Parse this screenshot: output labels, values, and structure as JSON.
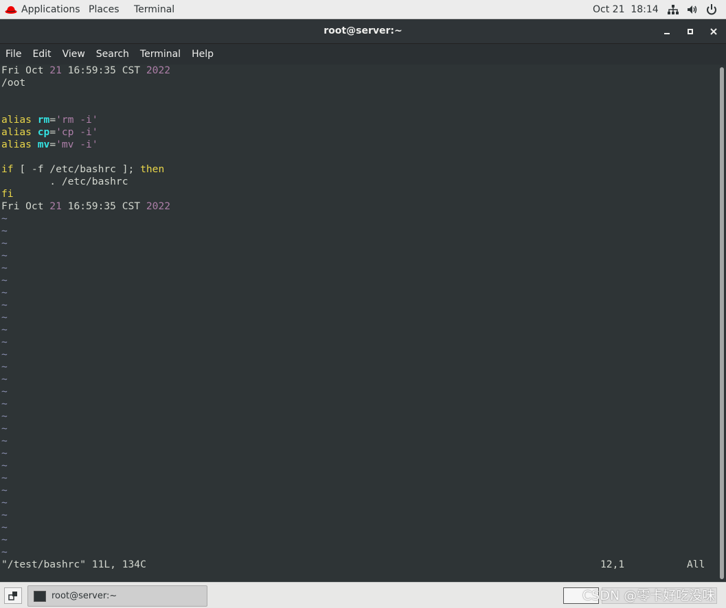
{
  "topbar": {
    "applications": "Applications",
    "places": "Places",
    "terminal": "Terminal",
    "datetime": "Oct 21  18:14",
    "icons": [
      "network-icon",
      "volume-icon",
      "power-icon"
    ],
    "hat_color": "#ee0000"
  },
  "window": {
    "title": "root@server:~",
    "buttons": [
      "minimize",
      "maximize",
      "close"
    ]
  },
  "menubar": {
    "items": [
      "File",
      "Edit",
      "View",
      "Search",
      "Terminal",
      "Help"
    ]
  },
  "editor": {
    "line1": {
      "a": "Fri Oct ",
      "b": "21",
      "c": " 16:59:35 CST ",
      "d": "2022"
    },
    "line2": "/oot",
    "alias_kw": "alias",
    "alias1": {
      "name": "rm",
      "eq": "=",
      "val": "'rm -i'"
    },
    "alias2": {
      "name": "cp",
      "eq": "=",
      "val": "'cp -i'"
    },
    "alias3": {
      "name": "mv",
      "eq": "=",
      "val": "'mv -i'"
    },
    "if_line": {
      "kw": "if",
      "mid": " [ -f /etc/bashrc ]; ",
      "then": "then"
    },
    "source_line": "        . /etc/bashrc",
    "fi": "fi",
    "line_last": {
      "a": "Fri Oct ",
      "b": "21",
      "c": " 16:59:35 CST ",
      "d": "2022"
    },
    "tilde": "~",
    "status": "\"/test/bashrc\" 11L, 134C",
    "cursor_pos": "12,1",
    "scroll_pos": "All",
    "colors": {
      "yellow": "#e9d64a",
      "cyan": "#34e2e2",
      "purple": "#ad7fa8",
      "tilde": "#8a8fb0",
      "bg": "#2e3436"
    }
  },
  "taskbar": {
    "task_label": "root@server:~",
    "watermark": "CSDN @零卡好吃没味"
  }
}
